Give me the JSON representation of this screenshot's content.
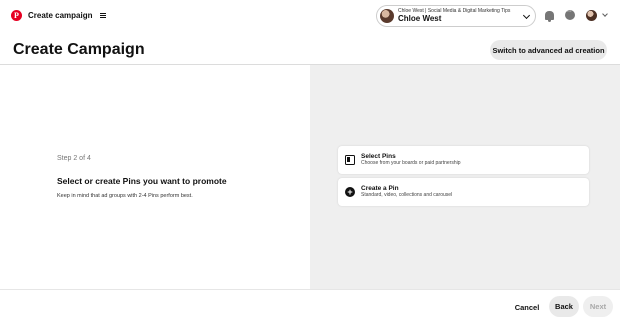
{
  "header": {
    "logo_icon": "pinterest-logo-icon",
    "logo_glyph": "P",
    "title": "Create campaign",
    "menu_icon": "hamburger-menu-icon"
  },
  "account": {
    "business_name": "Chloe West | Social Media & Digital Marketing Tips",
    "user_name": "Chloe West",
    "avatar_icon": "avatar",
    "dropdown_icon": "chevron-down-icon"
  },
  "topnav": {
    "notifications_icon": "bell-icon",
    "messages_icon": "chat-icon",
    "profile_icon": "avatar",
    "more_icon": "chevron-down-icon"
  },
  "page": {
    "title": "Create Campaign",
    "advanced_button": "Switch to advanced ad creation"
  },
  "step": {
    "label": "Step 2 of 4",
    "heading": "Select or create Pins you want to promote",
    "hint": "Keep in mind that ad groups with 2-4 Pins perform best."
  },
  "options": [
    {
      "icon": "board-icon",
      "title": "Select Pins",
      "description": "Choose from your boards or paid partnership"
    },
    {
      "icon": "plus-circle-icon",
      "title": "Create a Pin",
      "description": "Standard, video, collections and carousel"
    }
  ],
  "footer": {
    "cancel": "Cancel",
    "back": "Back",
    "next": "Next"
  },
  "colors": {
    "brand": "#e60023",
    "panel_bg": "#efefef",
    "button_bg": "#e9e9e9",
    "disabled_text": "#a8a8a8"
  }
}
